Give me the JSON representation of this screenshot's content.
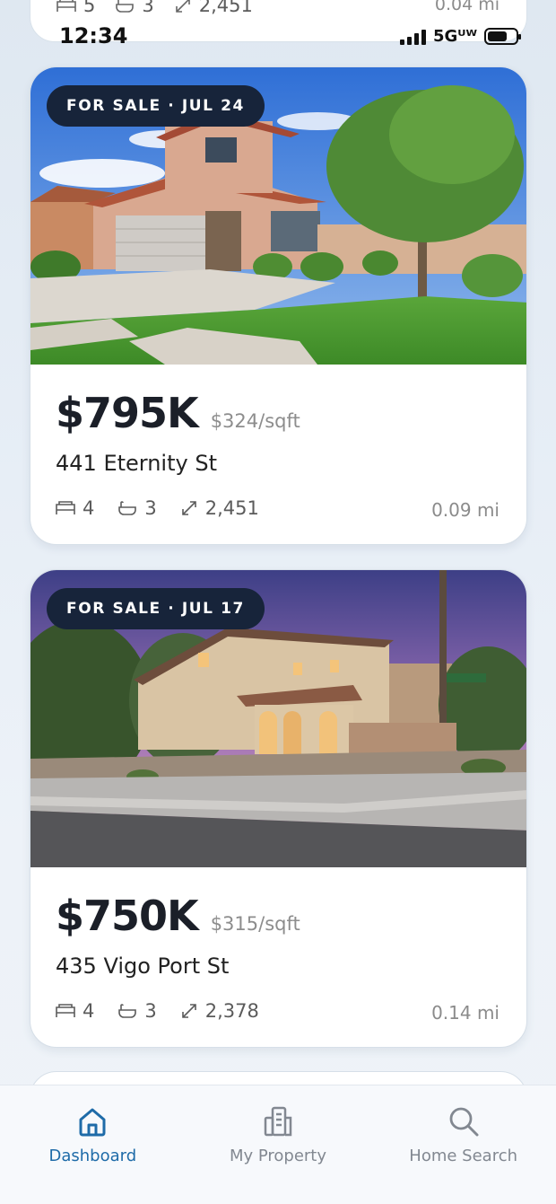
{
  "status_bar": {
    "time": "12:34",
    "network": "5Gᵁᵂ"
  },
  "partial_top_card": {
    "beds": "5",
    "baths": "3",
    "sqft": "2,451",
    "distance": "0.04 mi"
  },
  "listings": [
    {
      "badge": "FOR SALE · JUL 24",
      "price": "$795K",
      "price_per_sqft": "$324/sqft",
      "address": "441 Eternity St",
      "beds": "4",
      "baths": "3",
      "sqft": "2,451",
      "distance": "0.09 mi"
    },
    {
      "badge": "FOR SALE · JUL 17",
      "price": "$750K",
      "price_per_sqft": "$315/sqft",
      "address": "435 Vigo Port St",
      "beds": "4",
      "baths": "3",
      "sqft": "2,378",
      "distance": "0.14 mi"
    }
  ],
  "nav": {
    "items": [
      {
        "label": "Dashboard",
        "icon": "home-icon",
        "active": true
      },
      {
        "label": "My Property",
        "icon": "building-icon",
        "active": false
      },
      {
        "label": "Home Search",
        "icon": "search-icon",
        "active": false
      }
    ]
  },
  "colors": {
    "accent": "#1e6ba8",
    "badge_bg": "#17243a",
    "text_primary": "#1b1f28",
    "text_muted": "#8b8b8b"
  }
}
